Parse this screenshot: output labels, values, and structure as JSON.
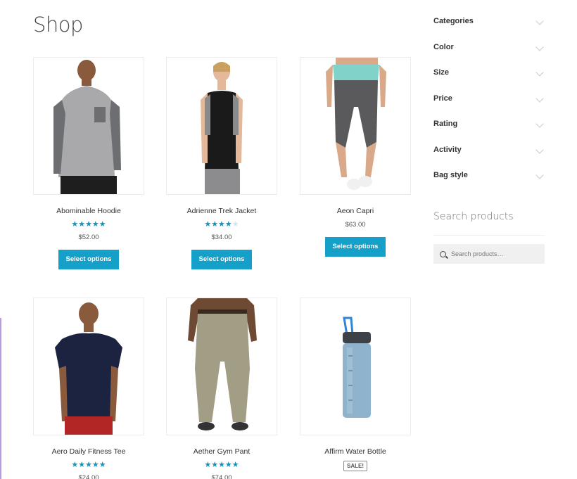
{
  "page": {
    "title": "Shop"
  },
  "products": [
    {
      "name": "Abominable Hoodie",
      "rating": 5,
      "rating_max": 5,
      "price": "$52.00",
      "button": "Select options"
    },
    {
      "name": "Adrienne Trek Jacket",
      "rating": 4,
      "rating_max": 5,
      "price": "$34.00",
      "button": "Select options"
    },
    {
      "name": "Aeon Capri",
      "rating": null,
      "rating_max": 5,
      "price": "$63.00",
      "button": "Select options"
    },
    {
      "name": "Aero Daily Fitness Tee",
      "rating": 5,
      "rating_max": 5,
      "price": "$24.00"
    },
    {
      "name": "Aether Gym Pant",
      "rating": 5,
      "rating_max": 5,
      "price": "$74.00"
    },
    {
      "name": "Affirm Water Bottle",
      "badge": "SALE!"
    }
  ],
  "sidebar": {
    "filters": [
      "Categories",
      "Color",
      "Size",
      "Price",
      "Rating",
      "Activity",
      "Bag style"
    ],
    "search_title": "Search products",
    "search_placeholder": "Search products…"
  },
  "colors": {
    "accent": "#15a0c9",
    "star": "#0f95c0"
  }
}
